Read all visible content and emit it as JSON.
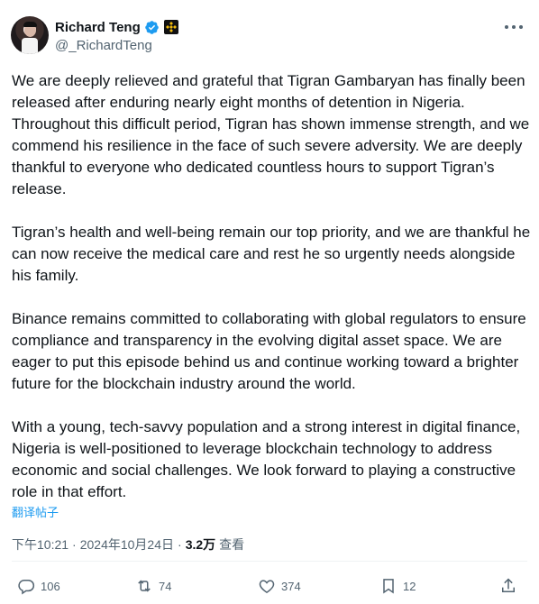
{
  "author": {
    "display_name": "Richard Teng",
    "handle": "@_RichardTeng",
    "verified": true,
    "affiliate_badge": "binance-icon"
  },
  "tweet": {
    "paragraphs": [
      "We are deeply relieved and grateful that Tigran Gambaryan has finally been released after enduring nearly eight months of detention in Nigeria. Throughout this difficult period, Tigran has shown immense strength, and we commend his resilience in the face of such severe adversity. We are deeply thankful to everyone who dedicated countless hours to support Tigran’s release.",
      "Tigran’s health and well-being remain our top priority, and we are thankful he can now receive the medical care and rest he so urgently needs alongside his family.",
      "Binance remains committed to collaborating with global regulators to ensure compliance and transparency in the evolving digital asset space. We are eager to put this episode behind us and continue working toward a brighter future for the blockchain industry around the world.",
      "With a young, tech-savvy population and a strong interest in digital finance, Nigeria is well-positioned to leverage blockchain technology to address economic and social challenges. We look forward to playing a constructive role in that effort."
    ],
    "translate_label": "翻译帖子"
  },
  "meta": {
    "time": "下午10:21",
    "date": "2024年10月24日",
    "separator": "·",
    "views": "3.2万",
    "views_label": "查看"
  },
  "actions": {
    "replies": "106",
    "reposts": "74",
    "likes": "374",
    "bookmarks": "12"
  },
  "colors": {
    "accent": "#1d9bf0",
    "secondary_text": "#536471",
    "primary_text": "#0f1419"
  }
}
